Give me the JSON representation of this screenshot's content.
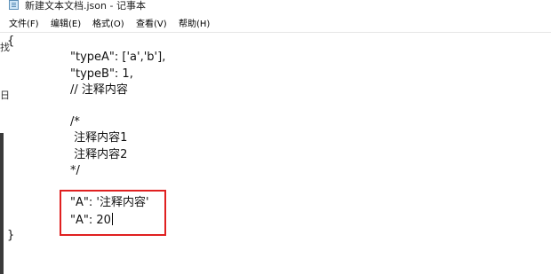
{
  "window": {
    "title": "新建文本文档.json - 记事本",
    "icon": "notepad-icon"
  },
  "menu": {
    "file": "文件(F)",
    "edit": "编辑(E)",
    "format": "格式(O)",
    "view": "查看(V)",
    "help": "帮助(H)"
  },
  "background_fragments": {
    "upper": "找",
    "lower": "日"
  },
  "editor": {
    "lines": [
      "{",
      "\"typeA\": ['a','b'],",
      "\"typeB\": 1,",
      "// 注释内容",
      "/*",
      " 注释内容1",
      " 注释内容2",
      "*/",
      "\"A\": '注释内容'",
      "\"A\": 20",
      "}"
    ]
  },
  "colors": {
    "highlight_border": "#e02020",
    "text": "#111111"
  }
}
